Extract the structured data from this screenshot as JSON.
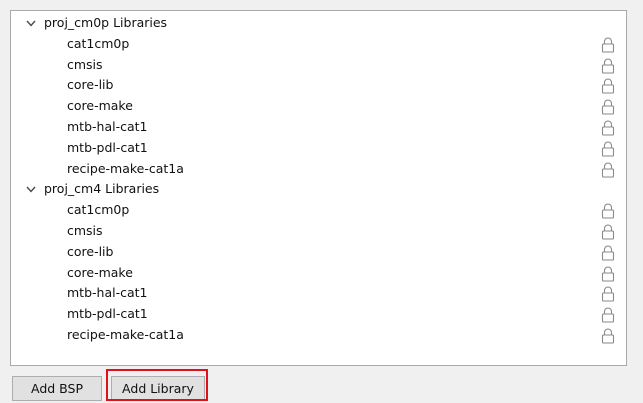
{
  "groups": [
    {
      "label": "proj_cm0p Libraries",
      "libraries": [
        "cat1cm0p",
        "cmsis",
        "core-lib",
        "core-make",
        "mtb-hal-cat1",
        "mtb-pdl-cat1",
        "recipe-make-cat1a"
      ]
    },
    {
      "label": "proj_cm4 Libraries",
      "libraries": [
        "cat1cm0p",
        "cmsis",
        "core-lib",
        "core-make",
        "mtb-hal-cat1",
        "mtb-pdl-cat1",
        "recipe-make-cat1a"
      ]
    }
  ],
  "icons": {
    "expand": "chevron-down-icon",
    "locked": "lock-icon"
  },
  "buttons": {
    "add_bsp": "Add BSP",
    "add_library": "Add Library"
  },
  "colors": {
    "highlight": "#e0101c",
    "lock_icon": "#8a8a8a"
  }
}
